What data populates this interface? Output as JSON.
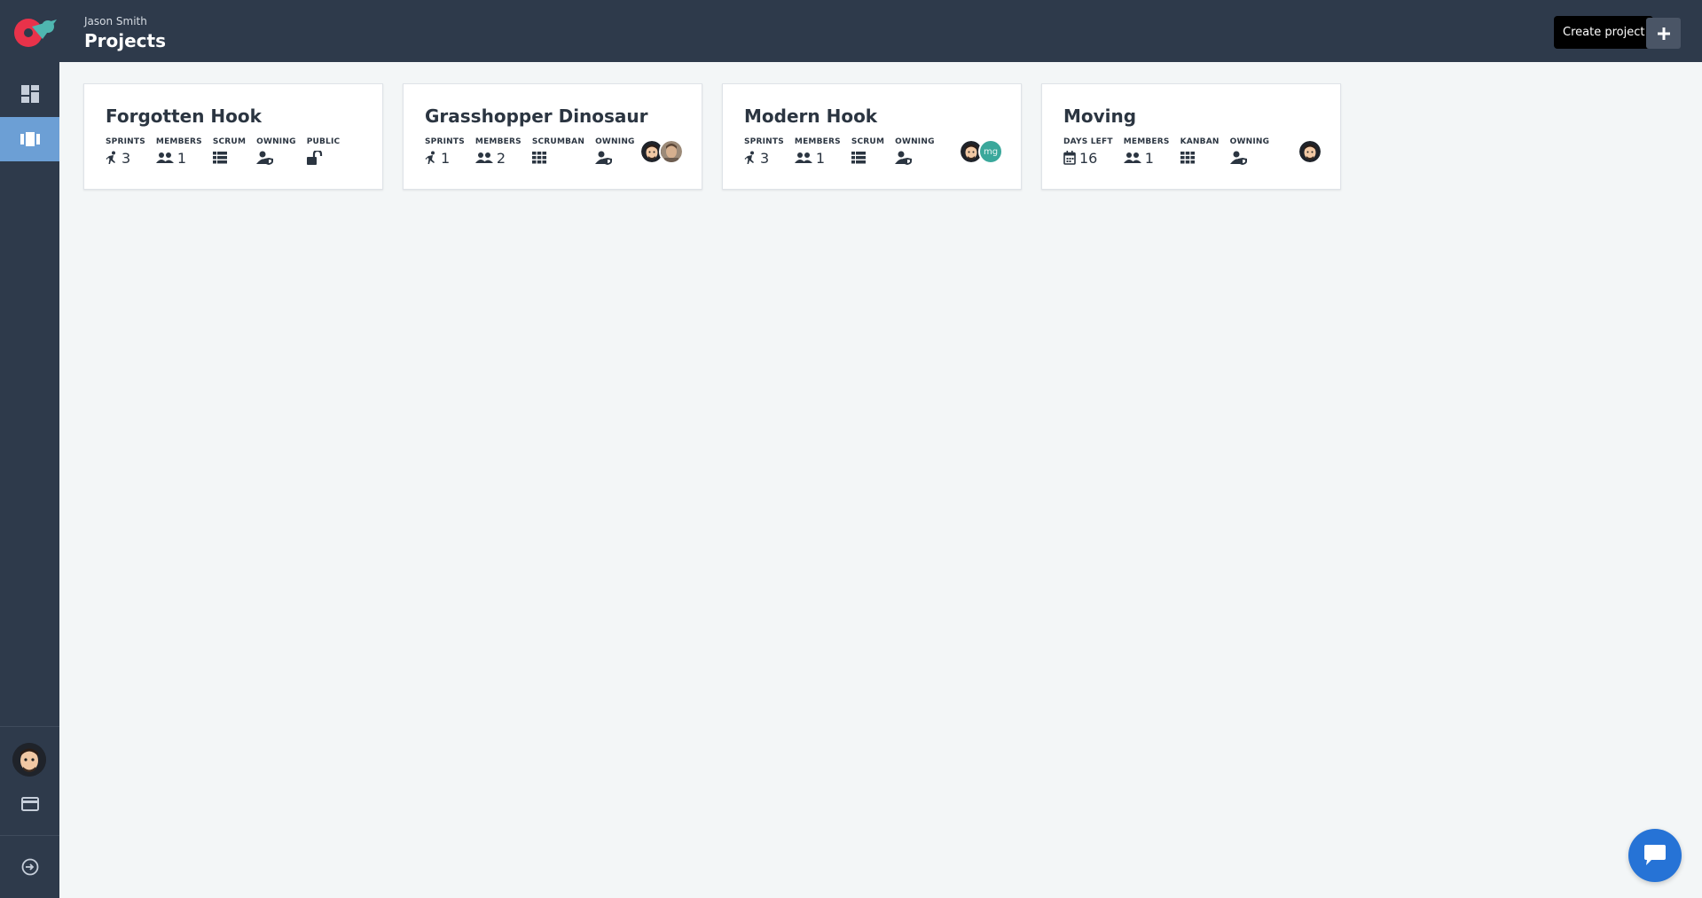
{
  "header": {
    "user_name": "Jason Smith",
    "title": "Projects",
    "create_tooltip": "Create project"
  },
  "sidebar": {
    "items": [
      {
        "icon": "dashboard-icon",
        "active": false
      },
      {
        "icon": "projects-icon",
        "active": true
      }
    ],
    "bottom": [
      {
        "icon": "avatar"
      },
      {
        "icon": "billing-card-icon"
      },
      {
        "icon": "logout-icon"
      }
    ]
  },
  "projects": [
    {
      "name": "Forgotten Hook",
      "stats": [
        {
          "label": "SPRINTS",
          "icon": "sprint-runner-icon",
          "value": "3"
        },
        {
          "label": "MEMBERS",
          "icon": "members-icon",
          "value": "1"
        },
        {
          "label": "SCRUM",
          "icon": "scrum-list-icon",
          "value": ""
        },
        {
          "label": "OWNING",
          "icon": "owner-shield-icon",
          "value": ""
        },
        {
          "label": "PUBLIC",
          "icon": "unlock-icon",
          "value": ""
        }
      ],
      "avatars": []
    },
    {
      "name": "Grasshopper Dinosaur",
      "stats": [
        {
          "label": "SPRINTS",
          "icon": "sprint-runner-icon",
          "value": "1"
        },
        {
          "label": "MEMBERS",
          "icon": "members-icon",
          "value": "2"
        },
        {
          "label": "SCRUMBAN",
          "icon": "grid-icon",
          "value": ""
        },
        {
          "label": "OWNING",
          "icon": "owner-shield-icon",
          "value": ""
        }
      ],
      "avatars": [
        "avatar-photo-1",
        "avatar-photo-2"
      ]
    },
    {
      "name": "Modern Hook",
      "stats": [
        {
          "label": "SPRINTS",
          "icon": "sprint-runner-icon",
          "value": "3"
        },
        {
          "label": "MEMBERS",
          "icon": "members-icon",
          "value": "1"
        },
        {
          "label": "SCRUM",
          "icon": "scrum-list-icon",
          "value": ""
        },
        {
          "label": "OWNING",
          "icon": "owner-shield-icon",
          "value": ""
        }
      ],
      "avatars": [
        "avatar-photo-1",
        "mg"
      ]
    },
    {
      "name": "Moving",
      "stats": [
        {
          "label": "DAYS LEFT",
          "icon": "calendar-icon",
          "value": "16"
        },
        {
          "label": "MEMBERS",
          "icon": "members-icon",
          "value": "1"
        },
        {
          "label": "KANBAN",
          "icon": "grid-icon",
          "value": ""
        },
        {
          "label": "OWNING",
          "icon": "owner-shield-icon",
          "value": ""
        }
      ],
      "avatars": [
        "avatar-photo-1"
      ]
    }
  ],
  "colors": {
    "topbar": "#2e3a4b",
    "sidebar_active": "#6c9fd5",
    "background": "#f3f6f7",
    "chat_button": "#2673d6",
    "logo_red": "#e8324a",
    "logo_teal": "#4fb6b0"
  }
}
